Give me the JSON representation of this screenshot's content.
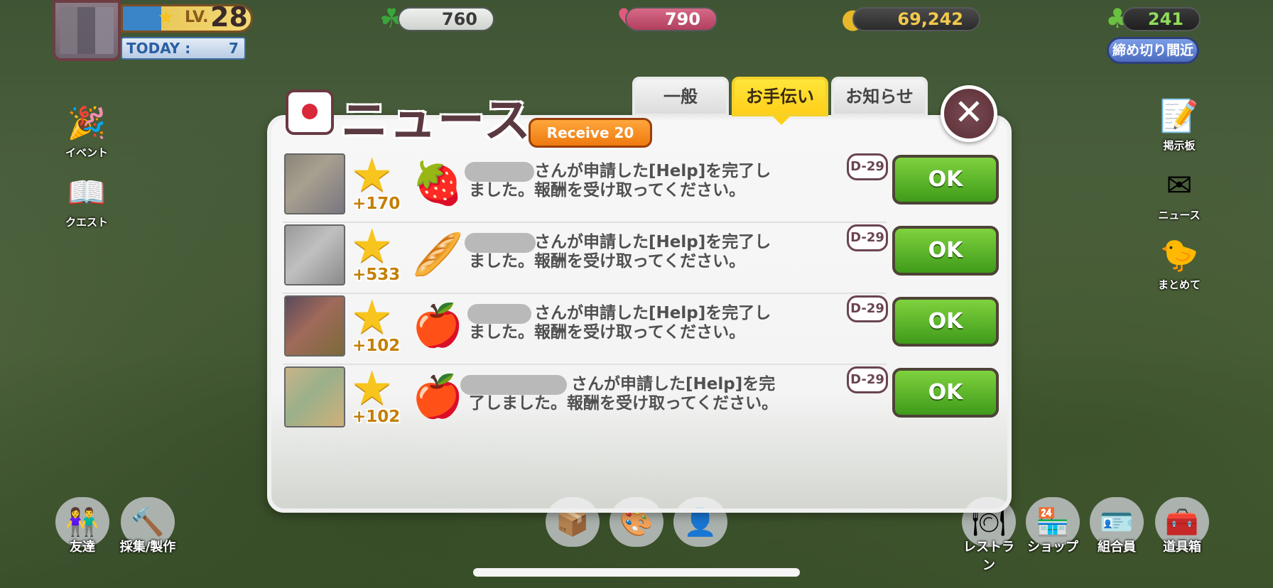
{
  "hud": {
    "level_label": "LV.",
    "level": "28",
    "today_label": "TODAY :",
    "today_value": "7",
    "clover": "760",
    "heart": "790",
    "coins": "69,242",
    "sprouts": "241",
    "deadline_label": "締め切り間近"
  },
  "left_menu": [
    {
      "label": "イベント",
      "icon": "party-popper-icon"
    },
    {
      "label": "クエスト",
      "icon": "quest-book-icon"
    }
  ],
  "right_menu": [
    {
      "label": "掲示板",
      "icon": "notepad-icon"
    },
    {
      "label": "ニュース",
      "icon": "envelope-icon"
    },
    {
      "label": "まとめて",
      "icon": "duck-icon"
    }
  ],
  "bottom_menu": [
    {
      "label": "友達",
      "icon": "friends-icon"
    },
    {
      "label": "採集/製作",
      "icon": "craft-icon"
    },
    {
      "label": "",
      "icon": "box-icon"
    },
    {
      "label": "",
      "icon": "palette-icon"
    },
    {
      "label": "",
      "icon": "character-icon"
    },
    {
      "label": "レストラン",
      "icon": "restaurant-icon"
    },
    {
      "label": "ショップ",
      "icon": "shop-icon"
    },
    {
      "label": "組合員",
      "icon": "member-card-icon"
    },
    {
      "label": "道具箱",
      "icon": "toolbox-icon"
    }
  ],
  "dialog": {
    "title": "ニュース",
    "receive_label": "Receive 20",
    "tabs": [
      {
        "label": "一般",
        "active": false
      },
      {
        "label": "お手伝い",
        "active": true
      },
      {
        "label": "お知らせ",
        "active": false
      }
    ],
    "close_label": "✕",
    "items": [
      {
        "points": "+170",
        "item_icon": "strawberry-jam-icon",
        "message": "さんが申請した[Help]を完了しました。報酬を受け取ってください。",
        "deadline": "D-29",
        "ok_label": "OK"
      },
      {
        "points": "+533",
        "item_icon": "bread-basket-icon",
        "message": "さんが申請した[Help]を完了しました。報酬を受け取ってください。",
        "deadline": "D-29",
        "ok_label": "OK"
      },
      {
        "points": "+102",
        "item_icon": "apple-jam-icon",
        "message": "さんが申請した[Help]を完了しました。報酬を受け取ってください。",
        "deadline": "D-29",
        "ok_label": "OK"
      },
      {
        "points": "+102",
        "item_icon": "apple-jam-icon",
        "message": "さんが申請した[Help]を完了しました。報酬を受け取ってください。",
        "deadline": "D-29",
        "ok_label": "OK"
      }
    ]
  },
  "colors": {
    "ok_green": "#4fae24",
    "tab_active": "#ffd61f",
    "receive_orange": "#f28a1c",
    "title_brown": "#5a3a40"
  }
}
